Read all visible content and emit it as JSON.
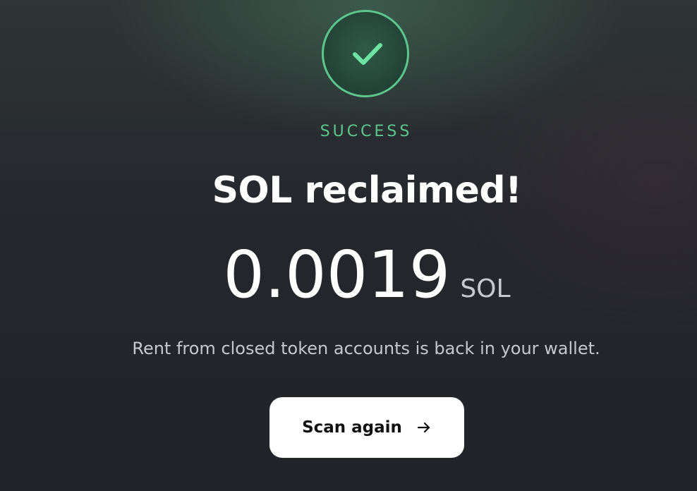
{
  "status": {
    "icon": "check-icon",
    "label": "SUCCESS",
    "color": "#5dc58e"
  },
  "title": "SOL reclaimed!",
  "amount": {
    "value": "0.0019",
    "unit": "SOL"
  },
  "message": "Rent from closed token accounts is back in your wallet.",
  "actions": {
    "scan_again_label": "Scan again",
    "scan_again_icon": "arrow-right-icon"
  }
}
